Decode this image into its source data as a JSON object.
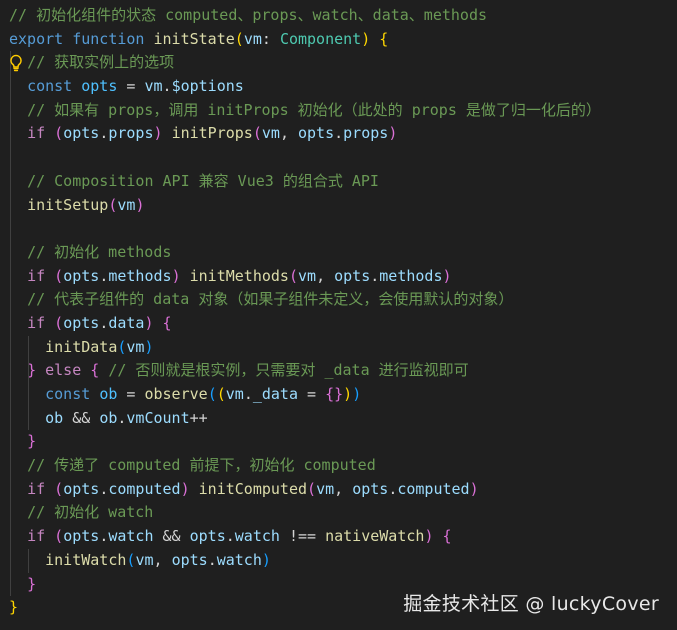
{
  "editor": {
    "lines": [
      [
        [
          "cm",
          "// 初始化组件的状态 computed、props、watch、data、methods"
        ]
      ],
      [
        [
          "kw",
          "export"
        ],
        [
          "pun",
          " "
        ],
        [
          "kw",
          "function"
        ],
        [
          "pun",
          " "
        ],
        [
          "fn",
          "initState"
        ],
        [
          "b1",
          "("
        ],
        [
          "var",
          "vm"
        ],
        [
          "pun",
          ": "
        ],
        [
          "typ",
          "Component"
        ],
        [
          "b1",
          ")"
        ],
        [
          "pun",
          " "
        ],
        [
          "b1",
          "{"
        ]
      ],
      [
        [
          "pun",
          "  "
        ],
        [
          "cm",
          "// 获取实例上的选项"
        ]
      ],
      [
        [
          "pun",
          "  "
        ],
        [
          "kw",
          "const"
        ],
        [
          "pun",
          " "
        ],
        [
          "cst",
          "opts"
        ],
        [
          "pun",
          " = "
        ],
        [
          "var",
          "vm"
        ],
        [
          "pun",
          "."
        ],
        [
          "var",
          "$options"
        ]
      ],
      [
        [
          "pun",
          "  "
        ],
        [
          "cm",
          "// 如果有 props，调用 initProps 初始化（此处的 props 是做了归一化后的）"
        ]
      ],
      [
        [
          "pun",
          "  "
        ],
        [
          "ctl",
          "if"
        ],
        [
          "pun",
          " "
        ],
        [
          "b2",
          "("
        ],
        [
          "var",
          "opts"
        ],
        [
          "pun",
          "."
        ],
        [
          "var",
          "props"
        ],
        [
          "b2",
          ")"
        ],
        [
          "pun",
          " "
        ],
        [
          "fn",
          "initProps"
        ],
        [
          "b2",
          "("
        ],
        [
          "var",
          "vm"
        ],
        [
          "pun",
          ", "
        ],
        [
          "var",
          "opts"
        ],
        [
          "pun",
          "."
        ],
        [
          "var",
          "props"
        ],
        [
          "b2",
          ")"
        ]
      ],
      [],
      [
        [
          "pun",
          "  "
        ],
        [
          "cm",
          "// Composition API 兼容 Vue3 的组合式 API"
        ]
      ],
      [
        [
          "pun",
          "  "
        ],
        [
          "fn",
          "initSetup"
        ],
        [
          "b2",
          "("
        ],
        [
          "var",
          "vm"
        ],
        [
          "b2",
          ")"
        ]
      ],
      [],
      [
        [
          "pun",
          "  "
        ],
        [
          "cm",
          "// 初始化 methods"
        ]
      ],
      [
        [
          "pun",
          "  "
        ],
        [
          "ctl",
          "if"
        ],
        [
          "pun",
          " "
        ],
        [
          "b2",
          "("
        ],
        [
          "var",
          "opts"
        ],
        [
          "pun",
          "."
        ],
        [
          "var",
          "methods"
        ],
        [
          "b2",
          ")"
        ],
        [
          "pun",
          " "
        ],
        [
          "fn",
          "initMethods"
        ],
        [
          "b2",
          "("
        ],
        [
          "var",
          "vm"
        ],
        [
          "pun",
          ", "
        ],
        [
          "var",
          "opts"
        ],
        [
          "pun",
          "."
        ],
        [
          "var",
          "methods"
        ],
        [
          "b2",
          ")"
        ]
      ],
      [
        [
          "pun",
          "  "
        ],
        [
          "cm",
          "// 代表子组件的 data 对象（如果子组件未定义，会使用默认的对象）"
        ]
      ],
      [
        [
          "pun",
          "  "
        ],
        [
          "ctl",
          "if"
        ],
        [
          "pun",
          " "
        ],
        [
          "b2",
          "("
        ],
        [
          "var",
          "opts"
        ],
        [
          "pun",
          "."
        ],
        [
          "var",
          "data"
        ],
        [
          "b2",
          ")"
        ],
        [
          "pun",
          " "
        ],
        [
          "b2",
          "{"
        ]
      ],
      [
        [
          "pun",
          "    "
        ],
        [
          "fn",
          "initData"
        ],
        [
          "b3",
          "("
        ],
        [
          "var",
          "vm"
        ],
        [
          "b3",
          ")"
        ]
      ],
      [
        [
          "pun",
          "  "
        ],
        [
          "b2",
          "}"
        ],
        [
          "pun",
          " "
        ],
        [
          "ctl",
          "else"
        ],
        [
          "pun",
          " "
        ],
        [
          "b2",
          "{"
        ],
        [
          "pun",
          " "
        ],
        [
          "cm",
          "// 否则就是根实例，只需要对 _data 进行监视即可"
        ]
      ],
      [
        [
          "pun",
          "    "
        ],
        [
          "kw",
          "const"
        ],
        [
          "pun",
          " "
        ],
        [
          "cst",
          "ob"
        ],
        [
          "pun",
          " = "
        ],
        [
          "fn",
          "observe"
        ],
        [
          "b3",
          "("
        ],
        [
          "b1",
          "("
        ],
        [
          "var",
          "vm"
        ],
        [
          "pun",
          "."
        ],
        [
          "var",
          "_data"
        ],
        [
          "pun",
          " = "
        ],
        [
          "b2",
          "{}"
        ],
        [
          "b1",
          ")"
        ],
        [
          "b3",
          ")"
        ]
      ],
      [
        [
          "pun",
          "    "
        ],
        [
          "var",
          "ob"
        ],
        [
          "pun",
          " && "
        ],
        [
          "var",
          "ob"
        ],
        [
          "pun",
          "."
        ],
        [
          "var",
          "vmCount"
        ],
        [
          "pun",
          "++"
        ]
      ],
      [
        [
          "pun",
          "  "
        ],
        [
          "b2",
          "}"
        ]
      ],
      [
        [
          "pun",
          "  "
        ],
        [
          "cm",
          "// 传递了 computed 前提下，初始化 computed"
        ]
      ],
      [
        [
          "pun",
          "  "
        ],
        [
          "ctl",
          "if"
        ],
        [
          "pun",
          " "
        ],
        [
          "b2",
          "("
        ],
        [
          "var",
          "opts"
        ],
        [
          "pun",
          "."
        ],
        [
          "var",
          "computed"
        ],
        [
          "b2",
          ")"
        ],
        [
          "pun",
          " "
        ],
        [
          "fn",
          "initComputed"
        ],
        [
          "b2",
          "("
        ],
        [
          "var",
          "vm"
        ],
        [
          "pun",
          ", "
        ],
        [
          "var",
          "opts"
        ],
        [
          "pun",
          "."
        ],
        [
          "var",
          "computed"
        ],
        [
          "b2",
          ")"
        ]
      ],
      [
        [
          "pun",
          "  "
        ],
        [
          "cm",
          "// 初始化 watch"
        ]
      ],
      [
        [
          "pun",
          "  "
        ],
        [
          "ctl",
          "if"
        ],
        [
          "pun",
          " "
        ],
        [
          "b2",
          "("
        ],
        [
          "var",
          "opts"
        ],
        [
          "pun",
          "."
        ],
        [
          "var",
          "watch"
        ],
        [
          "pun",
          " && "
        ],
        [
          "var",
          "opts"
        ],
        [
          "pun",
          "."
        ],
        [
          "var",
          "watch"
        ],
        [
          "pun",
          " !== "
        ],
        [
          "fn",
          "nativeWatch"
        ],
        [
          "b2",
          ")"
        ],
        [
          "pun",
          " "
        ],
        [
          "b2",
          "{"
        ]
      ],
      [
        [
          "pun",
          "    "
        ],
        [
          "fn",
          "initWatch"
        ],
        [
          "b3",
          "("
        ],
        [
          "var",
          "vm"
        ],
        [
          "pun",
          ", "
        ],
        [
          "var",
          "opts"
        ],
        [
          "pun",
          "."
        ],
        [
          "var",
          "watch"
        ],
        [
          "b3",
          ")"
        ]
      ],
      [
        [
          "pun",
          "  "
        ],
        [
          "b2",
          "}"
        ]
      ],
      [
        [
          "b1",
          "}"
        ]
      ]
    ],
    "lightbulb_line": 2,
    "lightbulb_icon": "lightbulb-icon",
    "lightbulb_color": "#ffcc00"
  },
  "watermark": "掘金技术社区 @ luckyCover"
}
